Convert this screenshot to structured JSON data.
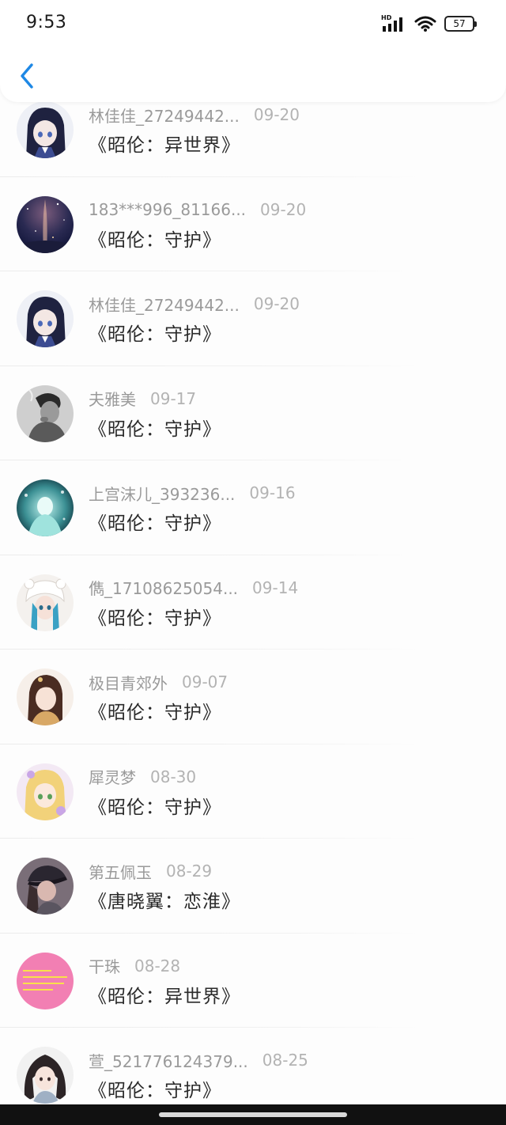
{
  "status_bar": {
    "time": "9:53",
    "network_label": "HD",
    "battery_level": "57"
  },
  "colors": {
    "accent": "#1e88e5",
    "name_text": "#9a9a9a",
    "date_text": "#b3b3b3",
    "title_text": "#2a2a2a"
  },
  "items": [
    {
      "name": "林佳佳_27249442...",
      "date": "09-20",
      "book": "《昭伦：异世界》",
      "avatar": "anime-girl-dark-hair-avatar"
    },
    {
      "name": "183***996_81166...",
      "date": "09-20",
      "book": "《昭伦：守护》",
      "avatar": "night-sky-avatar"
    },
    {
      "name": "林佳佳_27249442...",
      "date": "09-20",
      "book": "《昭伦：守护》",
      "avatar": "anime-girl-dark-hair-avatar"
    },
    {
      "name": "夫雅美",
      "date": "09-17",
      "book": "《昭伦：守护》",
      "avatar": "man-smoking-avatar"
    },
    {
      "name": "上宫沫儿_393236...",
      "date": "09-16",
      "book": "《昭伦：守护》",
      "avatar": "teal-fantasy-avatar"
    },
    {
      "name": "儁_17108625054...",
      "date": "09-14",
      "book": "《昭伦：守护》",
      "avatar": "girl-bear-hat-avatar"
    },
    {
      "name": "极目青郊外",
      "date": "09-07",
      "book": "《昭伦：守护》",
      "avatar": "brown-hair-girl-avatar"
    },
    {
      "name": "犀灵梦",
      "date": "08-30",
      "book": "《昭伦：守护》",
      "avatar": "blonde-anime-girl-avatar"
    },
    {
      "name": "第五佩玉",
      "date": "08-29",
      "book": "《唐晓翼：恋淮》",
      "avatar": "girl-cap-avatar"
    },
    {
      "name": "干珠",
      "date": "08-28",
      "book": "《昭伦：异世界》",
      "avatar": "pink-text-avatar"
    },
    {
      "name": "萱_521776124379...",
      "date": "08-25",
      "book": "《昭伦：守护》",
      "avatar": "curly-hair-girl-avatar"
    }
  ]
}
